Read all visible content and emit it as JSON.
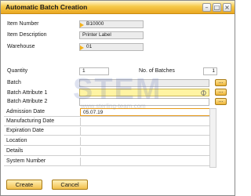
{
  "window": {
    "title": "Automatic Batch Creation"
  },
  "header_fields": {
    "item_number": {
      "label": "Item Number",
      "value": "B10000"
    },
    "item_description": {
      "label": "Item Description",
      "value": "Printer Label"
    },
    "warehouse": {
      "label": "Warehouse",
      "value": "01"
    }
  },
  "quantity": {
    "label": "Quantity",
    "value": "1"
  },
  "no_of_batches": {
    "label": "No. of Batches",
    "value": "1"
  },
  "batch": {
    "label": "Batch",
    "value": "",
    "button": "..."
  },
  "batch_attribute_1": {
    "label": "Batch Attribute 1",
    "value": "",
    "button": "..."
  },
  "batch_attribute_2": {
    "label": "Batch Attribute 2",
    "value": "",
    "button": "..."
  },
  "details_grid": [
    {
      "label": "Admission Date",
      "value": "05.07.19"
    },
    {
      "label": "Manufacturing Date",
      "value": ""
    },
    {
      "label": "Expiration Date",
      "value": ""
    },
    {
      "label": "Location",
      "value": ""
    },
    {
      "label": "Details",
      "value": ""
    },
    {
      "label": "System Number",
      "value": ""
    }
  ],
  "buttons": {
    "create": "Create",
    "cancel": "Cancel"
  },
  "watermark": {
    "brand": "STEM",
    "url": "www.sterling-team.com"
  },
  "icons": [
    "restore-icon",
    "maximize-icon",
    "close-icon",
    "link-arrow-icon",
    "ellipsis-icon",
    "edit-cursor-icon"
  ],
  "colors": {
    "titlebar": "#f6c94a",
    "active_field": "#fff4a3",
    "button": "#f2c04a"
  }
}
